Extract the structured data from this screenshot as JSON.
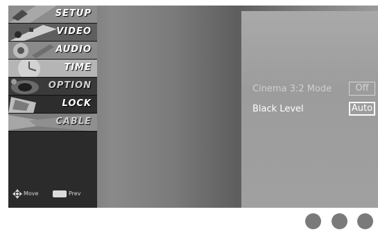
{
  "menu": {
    "items": [
      {
        "label": "SETUP",
        "icon": "setup-icon"
      },
      {
        "label": "VIDEO",
        "icon": "video-icon"
      },
      {
        "label": "AUDIO",
        "icon": "audio-icon"
      },
      {
        "label": "TIME",
        "icon": "time-icon"
      },
      {
        "label": "OPTION",
        "icon": "option-icon"
      },
      {
        "label": "LOCK",
        "icon": "lock-icon"
      },
      {
        "label": "CABLE",
        "icon": "cable-icon"
      }
    ]
  },
  "hints": {
    "move_label": "Move",
    "move_icon": "move-icon",
    "prev_label": "Prev",
    "prev_icon": "menu-key-icon"
  },
  "panel": {
    "rows": [
      {
        "name": "Cinema 3:2 Mode",
        "value": "Off",
        "selected": false
      },
      {
        "name": "Black Level",
        "value": "Auto",
        "selected": true
      }
    ]
  },
  "colors": {
    "sidebar": "#2b2b2b",
    "panel": "#a3a3a3",
    "dot": "#7a7a7a",
    "highlight_text": "#ffffff"
  }
}
